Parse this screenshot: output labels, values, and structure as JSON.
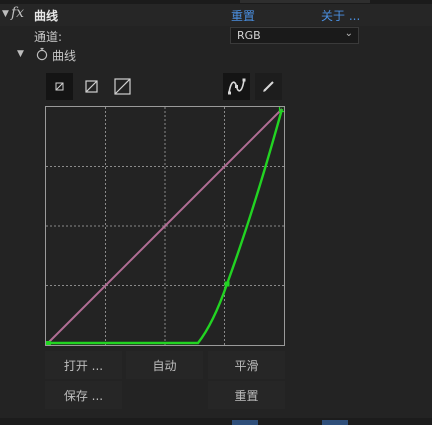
{
  "effect": {
    "fx_label": "fx",
    "name": "曲线",
    "reset_link": "重置",
    "about_link": "关于 ..."
  },
  "channel": {
    "label": "通道:",
    "value": "RGB"
  },
  "group": {
    "label": "曲线"
  },
  "toolbar": {
    "size_small": "small-graph-icon",
    "size_medium": "medium-graph-icon",
    "size_large": "large-graph-icon",
    "bezier_tool": "bezier-curve-icon",
    "pencil_tool": "pencil-icon"
  },
  "curves": {
    "baseline_color": "#b06d94",
    "curve_color": "#22d422",
    "grid": "dashed 4x4"
  },
  "buttons": {
    "open": "打开 ...",
    "auto": "自动",
    "smooth": "平滑",
    "save": "保存 ...",
    "reset": "重置"
  }
}
